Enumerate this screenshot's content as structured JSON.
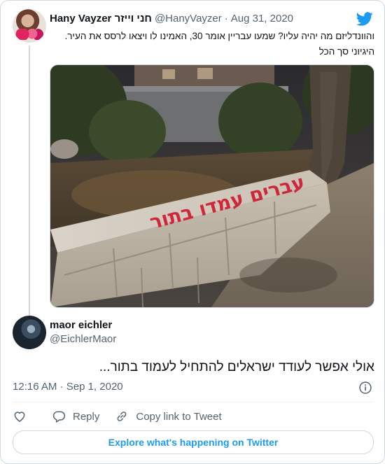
{
  "parent_tweet": {
    "author_name": "Hany Vayzer חני וייזר",
    "author_handle": "@HanyVayzer",
    "separator": "·",
    "date": "Aug 31, 2020",
    "text": "והוונדליזם מה יהיה עליו? שמעו עבריין אומר 30, האמינו לו ויצאו לרסס את העיר. היגיוני סך הכל",
    "photo": {
      "graffiti_text": "עברים עמדו בתור"
    }
  },
  "reply_tweet": {
    "author_name": "maor eichler",
    "author_handle": "@EichlerMaor",
    "text": "אולי אפשר לעודד ישראלים להתחיל לעמוד בתור...",
    "time": "12:16 AM",
    "separator": "·",
    "date": "Sep 1, 2020"
  },
  "actions": {
    "reply_label": "Reply",
    "copy_link_label": "Copy link to Tweet"
  },
  "explore": {
    "label": "Explore what's happening on Twitter"
  },
  "colors": {
    "twitter_blue": "#1d9bf0",
    "secondary_text": "#536471",
    "border": "#cfd9de"
  },
  "icons": [
    "twitter-logo-icon",
    "info-icon",
    "heart-icon",
    "reply-icon",
    "link-icon"
  ]
}
